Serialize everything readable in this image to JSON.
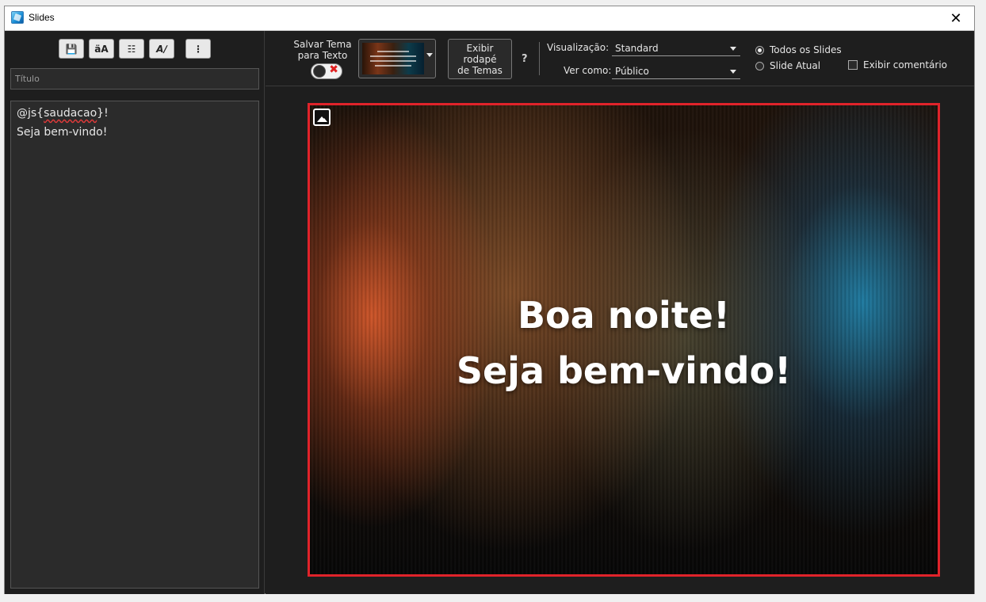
{
  "window": {
    "title": "Slides",
    "close_glyph": "✕"
  },
  "left_toolbar": {
    "buttons": [
      {
        "name": "save-icon",
        "glyph": "💾"
      },
      {
        "name": "font-size-icon",
        "glyph": "äA"
      },
      {
        "name": "slide-settings-icon",
        "glyph": "☷"
      },
      {
        "name": "spellcheck-icon",
        "glyph": "A∕"
      },
      {
        "name": "more-options-icon",
        "glyph": "⋮"
      }
    ]
  },
  "title_input": {
    "placeholder": "Título",
    "value": ""
  },
  "editor": {
    "line1_prefix": "@js{",
    "line1_var": "saudacao",
    "line1_suffix": "}!",
    "line2": "Seja bem-vindo!"
  },
  "toolbar": {
    "save_theme_line1": "Salvar Tema",
    "save_theme_line2": "para Texto",
    "toggle_x": "✖",
    "footer_line1": "Exibir",
    "footer_line2": "rodapé",
    "footer_line3": "de Temas",
    "help": "?",
    "visualizacao_label": "Visualização:",
    "visualizacao_value": "Standard",
    "ver_como_label": "Ver como:",
    "ver_como_value": "Público",
    "radio_all": "Todos os Slides",
    "radio_current": "Slide Atual",
    "checkbox_comment": "Exibir comentário"
  },
  "slide": {
    "line1": "Boa noite!",
    "line2": "Seja bem-vindo!"
  },
  "colors": {
    "slide_border": "#e0232a",
    "panel_bg": "#1e1e1e",
    "editor_bg": "#2b2b2b"
  }
}
